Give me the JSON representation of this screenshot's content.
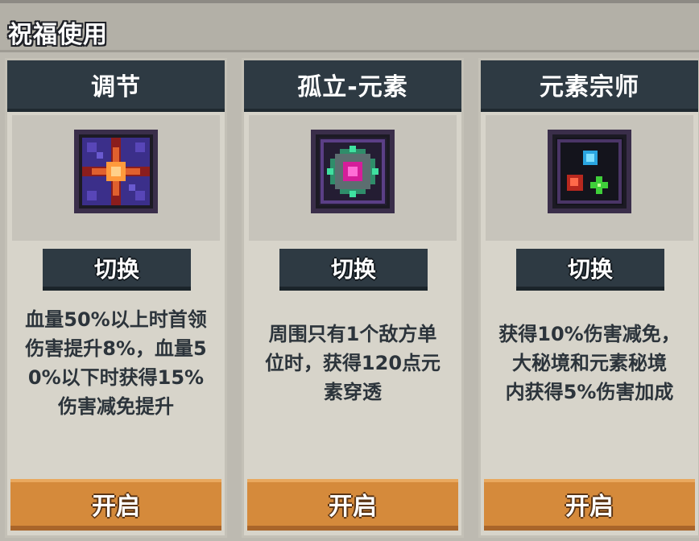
{
  "header": {
    "title": "祝福使用"
  },
  "cards": [
    {
      "title": "调节",
      "icon": "adjust-blessing-icon",
      "switch_label": "切换",
      "description_lines": [
        "血量50%以上时首领",
        "伤害提升8%，血量5",
        "0%以下时获得15%",
        "伤害减免提升"
      ],
      "open_label": "开启"
    },
    {
      "title": "孤立-元素",
      "icon": "isolation-element-blessing-icon",
      "switch_label": "切换",
      "description_lines": [
        "周围只有1个敌方单",
        "位时，获得120点元",
        "素穿透"
      ],
      "open_label": "开启"
    },
    {
      "title": "元素宗师",
      "icon": "element-master-blessing-icon",
      "switch_label": "切换",
      "description_lines": [
        "获得10%伤害减免，",
        "大秘境和元素秘境",
        "内获得5%伤害加成"
      ],
      "open_label": "开启"
    }
  ],
  "colors": {
    "card_header": "#2e3a43",
    "open_button": "#d58a3b",
    "text_dark": "#2c343b"
  }
}
